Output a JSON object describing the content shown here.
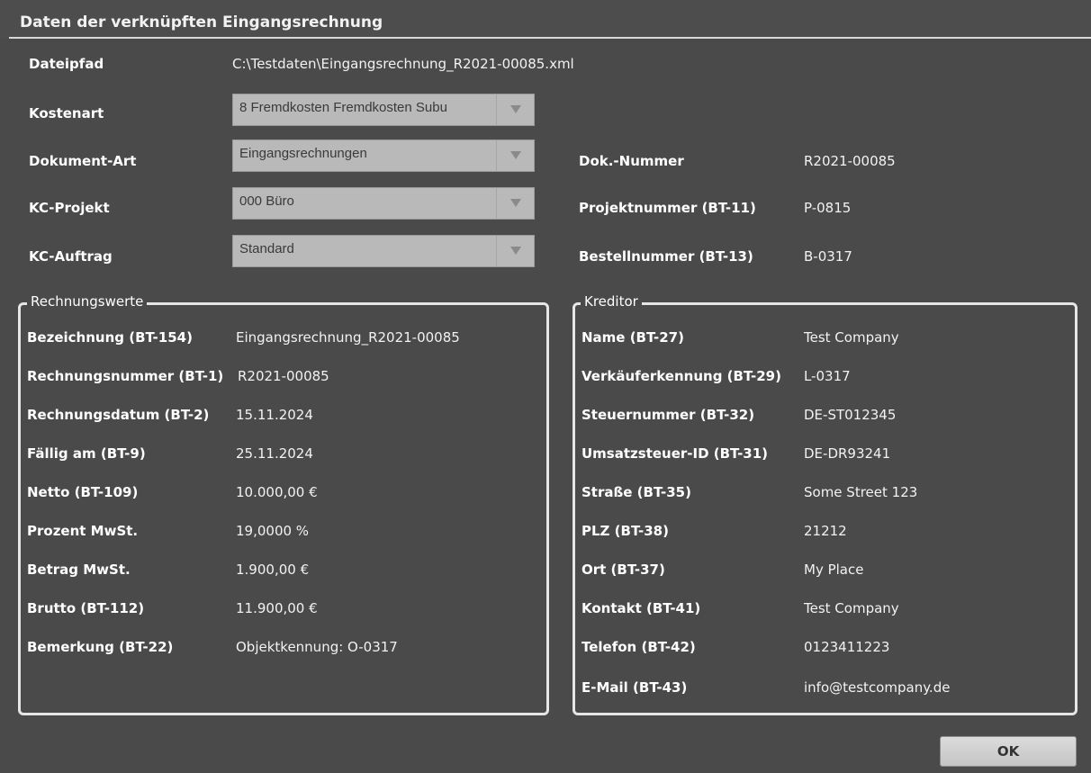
{
  "window": {
    "title": "Daten der verknüpften Eingangsrechnung"
  },
  "top": {
    "dateipfad_label": "Dateipfad",
    "dateipfad_value": "C:\\Testdaten\\Eingangsrechnung_R2021-00085.xml",
    "kostenart_label": "Kostenart",
    "kostenart_value": "8 Fremdkosten Fremdkosten Subu",
    "dokumentart_label": "Dokument-Art",
    "dokumentart_value": "Eingangsrechnungen",
    "kcprojekt_label": "KC-Projekt",
    "kcprojekt_value": "000 Büro",
    "kcauftrag_label": "KC-Auftrag",
    "kcauftrag_value": "Standard",
    "doknummer_label": "Dok.-Nummer",
    "doknummer_value": "R2021-00085",
    "projektnummer_label": "Projektnummer (BT-11)",
    "projektnummer_value": "P-0815",
    "bestellnummer_label": "Bestellnummer (BT-13)",
    "bestellnummer_value": "B-0317"
  },
  "rechnungswerte": {
    "title": "Rechnungswerte",
    "rows": [
      {
        "label": "Bezeichnung (BT-154)",
        "value": "Eingangsrechnung_R2021-00085"
      },
      {
        "label": "Rechnungsnummer (BT-1)",
        "value": "R2021-00085"
      },
      {
        "label": "Rechnungsdatum (BT-2)",
        "value": "15.11.2024"
      },
      {
        "label": "Fällig am (BT-9)",
        "value": "25.11.2024"
      },
      {
        "label": "Netto (BT-109)",
        "value": "10.000,00 €"
      },
      {
        "label": "Prozent MwSt.",
        "value": "19,0000 %"
      },
      {
        "label": "Betrag MwSt.",
        "value": "1.900,00 €"
      },
      {
        "label": "Brutto (BT-112)",
        "value": "11.900,00 €"
      },
      {
        "label": "Bemerkung (BT-22)",
        "value": "Objektkennung: O-0317"
      }
    ]
  },
  "kreditor": {
    "title": "Kreditor",
    "rows": [
      {
        "label": "Name (BT-27)",
        "value": "Test Company"
      },
      {
        "label": "Verkäuferkennung (BT-29)",
        "value": "L-0317"
      },
      {
        "label": "Steuernummer (BT-32)",
        "value": "DE-ST012345"
      },
      {
        "label": "Umsatzsteuer-ID (BT-31)",
        "value": "DE-DR93241"
      },
      {
        "label": "Straße (BT-35)",
        "value": "Some Street 123"
      },
      {
        "label": "PLZ (BT-38)",
        "value": "21212"
      },
      {
        "label": "Ort (BT-37)",
        "value": "My Place"
      },
      {
        "label": "Kontakt (BT-41)",
        "value": "Test Company"
      },
      {
        "label": "Telefon (BT-42)",
        "value": "0123411223"
      },
      {
        "label": "E-Mail (BT-43)",
        "value": "info@testcompany.de"
      }
    ]
  },
  "footer": {
    "ok_label": "OK"
  },
  "icons": {
    "dropdown": "chevron-down-icon"
  }
}
